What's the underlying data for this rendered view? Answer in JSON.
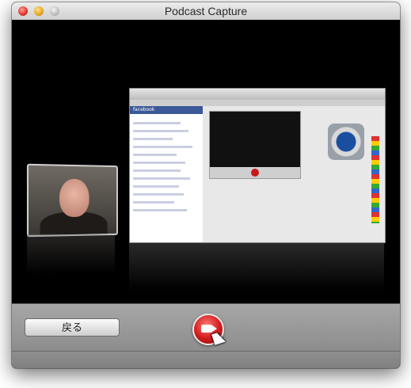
{
  "window": {
    "title": "Podcast Capture"
  },
  "preview": {
    "facebook_label": "facebook"
  },
  "controls": {
    "back_label": "戻る",
    "record_icon": "record-video-icon"
  },
  "colors": {
    "record": "#d21a1a",
    "stage": "#000000"
  }
}
